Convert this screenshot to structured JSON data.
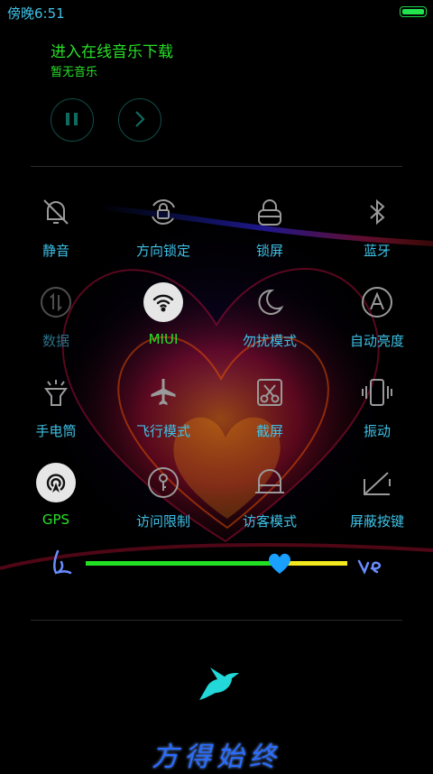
{
  "status_bar": {
    "time": "傍晚6:51",
    "battery_level": 1.0
  },
  "music": {
    "title": "进入在线音乐下载",
    "subtitle": "暂无音乐",
    "pause_icon": "pause-icon",
    "next_icon": "chevron-right-icon"
  },
  "toggles": [
    {
      "label": "静音",
      "icon": "bell-off-icon",
      "active": false
    },
    {
      "label": "方向锁定",
      "icon": "rotation-lock-icon",
      "active": false
    },
    {
      "label": "锁屏",
      "icon": "lock-icon",
      "active": false
    },
    {
      "label": "蓝牙",
      "icon": "bluetooth-icon",
      "active": false
    },
    {
      "label": "数据",
      "icon": "mobile-data-icon",
      "active": false
    },
    {
      "label": "MIUI",
      "icon": "wifi-icon",
      "active": true
    },
    {
      "label": "勿扰模式",
      "icon": "moon-icon",
      "active": false
    },
    {
      "label": "自动亮度",
      "icon": "auto-brightness-icon",
      "active": false
    },
    {
      "label": "手电筒",
      "icon": "flashlight-icon",
      "active": false
    },
    {
      "label": "飞行模式",
      "icon": "airplane-icon",
      "active": false
    },
    {
      "label": "截屏",
      "icon": "screenshot-scissors-icon",
      "active": false
    },
    {
      "label": "振动",
      "icon": "vibrate-icon",
      "active": false
    },
    {
      "label": "GPS",
      "icon": "gps-icon",
      "active": true
    },
    {
      "label": "访问限制",
      "icon": "key-icon",
      "active": false
    },
    {
      "label": "访客模式",
      "icon": "guest-icon",
      "active": false
    },
    {
      "label": "屏蔽按键",
      "icon": "keys-disabled-icon",
      "active": false
    }
  ],
  "brightness": {
    "level": 0.74,
    "colors": {
      "fill": "#22e022",
      "track": "#f2e81e",
      "knob": "#1aa0ff"
    }
  },
  "footer": {
    "signature": "方得始终",
    "bird_icon": "hummingbird-icon"
  },
  "colors": {
    "label": "#3ec1e6",
    "active_label": "#28e028",
    "icon": "#9a9a9a",
    "active_bg": "#e6e6e6"
  }
}
